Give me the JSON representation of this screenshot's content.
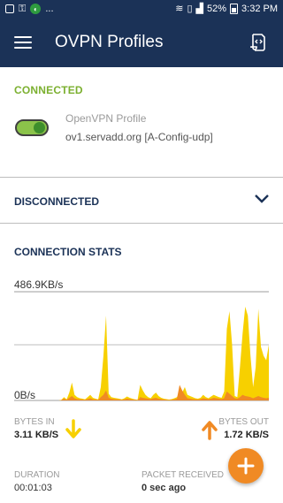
{
  "status_bar": {
    "left_text": "...",
    "battery": "52%",
    "time": "3:32 PM",
    "icons": [
      "alert-icon",
      "key-icon",
      "vpn-shield-icon",
      "wifi-icon",
      "sim-icon",
      "signal-icon",
      "battery-icon"
    ]
  },
  "appbar": {
    "title": "OVPN Profiles",
    "menu_icon": "hamburger-icon",
    "action_icon": "import-file-icon"
  },
  "connected": {
    "section_label": "CONNECTED",
    "profile_name": "OpenVPN Profile",
    "profile_server": "ov1.servadd.org [A-Config-udp]",
    "toggle_on": true
  },
  "disconnected": {
    "section_label": "DISCONNECTED"
  },
  "stats": {
    "section_label": "CONNECTION STATS",
    "max_label": "486.9KB/s",
    "min_label": "0B/s",
    "bytes_in_label": "BYTES IN",
    "bytes_in_value": "3.11 KB/S",
    "bytes_out_label": "BYTES OUT",
    "bytes_out_value": "1.72 KB/S",
    "duration_label": "DURATION",
    "duration_value": "00:01:03",
    "packet_label": "PACKET RECEIVED",
    "packet_value": "0 sec ago"
  },
  "colors": {
    "primary": "#1b3257",
    "connected_green": "#7cb030",
    "bytes_in": "#f7d000",
    "bytes_out": "#f08a24",
    "fab": "#f08a24"
  },
  "chart_data": {
    "type": "area",
    "ylim": [
      0,
      486.9
    ],
    "y_unit": "KB/s",
    "series": [
      {
        "values": [
          0,
          0,
          0,
          0,
          0,
          0,
          0,
          0,
          0,
          0,
          0,
          0,
          0,
          0,
          0,
          0,
          0,
          0,
          3,
          15,
          5,
          35,
          80,
          25,
          15,
          10,
          8,
          5,
          15,
          25,
          12,
          8,
          5,
          60,
          200,
          380,
          30,
          15,
          12,
          10,
          8,
          5,
          10,
          18,
          12,
          8,
          5,
          3,
          70,
          45,
          25,
          15,
          10,
          25,
          35,
          20,
          12,
          8,
          6,
          4,
          6,
          10,
          15,
          40,
          35,
          60,
          25,
          20,
          15,
          10,
          8,
          12,
          25,
          15,
          10,
          18,
          25,
          20,
          15,
          12,
          40,
          320,
          400,
          250,
          20,
          15,
          150,
          300,
          420,
          380,
          200,
          60,
          150,
          410,
          240,
          200,
          180,
          250
        ]
      },
      {
        "values": [
          0,
          0,
          0,
          0,
          0,
          0,
          0,
          0,
          0,
          0,
          0,
          0,
          0,
          0,
          0,
          0,
          0,
          0,
          2,
          8,
          3,
          12,
          20,
          10,
          6,
          5,
          4,
          3,
          6,
          10,
          5,
          4,
          3,
          15,
          25,
          45,
          12,
          8,
          6,
          5,
          4,
          3,
          5,
          8,
          6,
          4,
          3,
          2,
          15,
          12,
          10,
          8,
          6,
          10,
          12,
          8,
          6,
          4,
          3,
          2,
          3,
          5,
          8,
          70,
          45,
          25,
          10,
          8,
          6,
          5,
          4,
          6,
          10,
          8,
          6,
          8,
          12,
          10,
          8,
          6,
          10,
          40,
          30,
          20,
          10,
          8,
          15,
          25,
          20,
          18,
          15,
          10,
          15,
          20,
          15,
          12,
          10,
          12
        ]
      }
    ]
  }
}
